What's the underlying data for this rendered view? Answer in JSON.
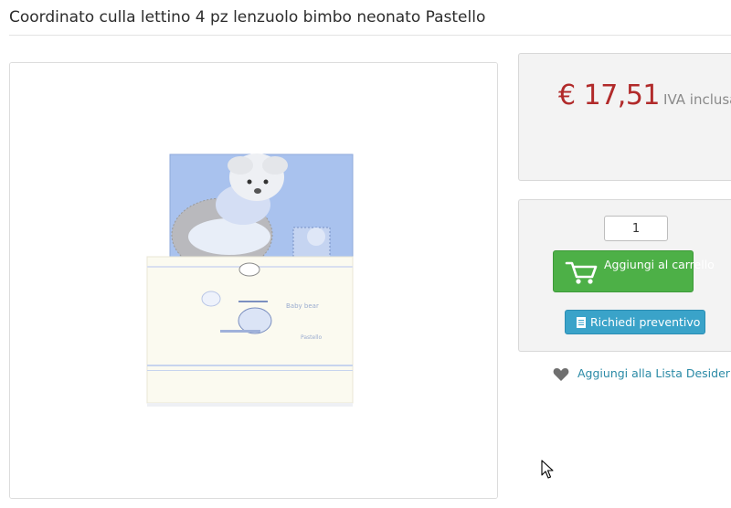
{
  "product": {
    "title": "Coordinato culla lettino 4 pz lenzuolo bimbo neonato Pastello",
    "image_alt": "Coordinato culla lettino Pastello"
  },
  "price": {
    "amount": "€ 17,51",
    "vat_note": "IVA inclusa"
  },
  "cart": {
    "quantity": "1",
    "add_to_cart_label": "Aggiungi al carrello",
    "quote_label": "Richiedi preventivo"
  },
  "wishlist": {
    "label": "Aggiungi alla Lista Desideri"
  },
  "colors": {
    "price": "#b12a2a",
    "cart_button": "#4db047",
    "quote_button": "#3aa3c9",
    "link": "#2a8aa6"
  },
  "icons": [
    "cart-icon",
    "document-icon",
    "heart-icon",
    "mouse-cursor-icon"
  ]
}
